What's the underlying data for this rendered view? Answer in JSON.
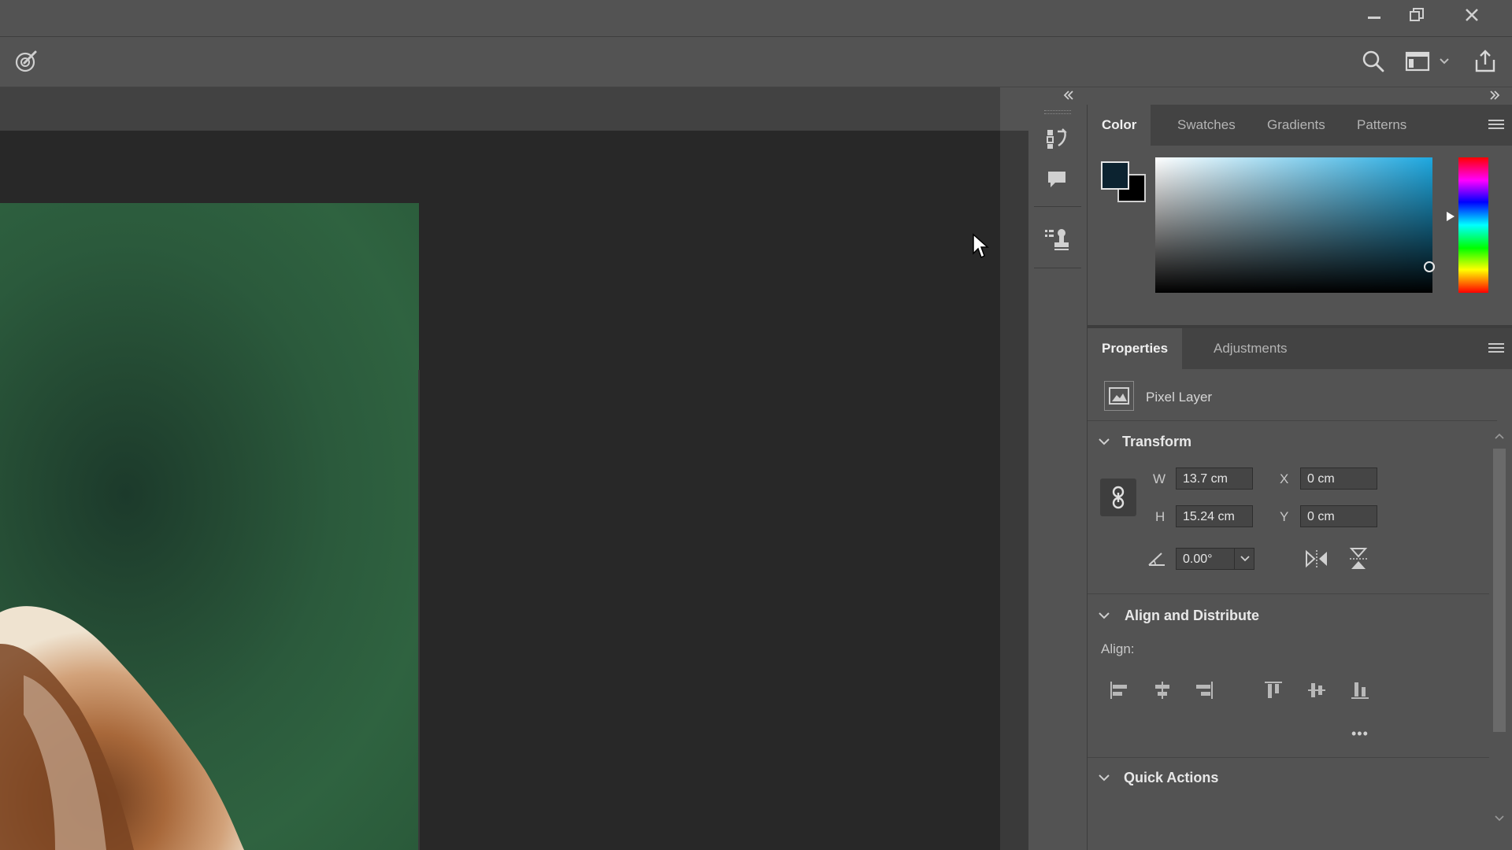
{
  "titlebar": {
    "buttons": [
      "minimize-icon",
      "restore-icon",
      "close-icon"
    ]
  },
  "toolbar": {
    "left_icon": "brush-target-icon",
    "right_icons": [
      "search-icon",
      "workspace-icon",
      "chevron-down-icon",
      "share-icon"
    ]
  },
  "color_panel": {
    "tabs": [
      "Color",
      "Swatches",
      "Gradients",
      "Patterns"
    ],
    "active_tab": "Color",
    "foreground_color": "#0c2330",
    "background_color": "#000000",
    "hue_color": "#1ea8e0"
  },
  "properties_panel": {
    "tabs": [
      "Properties",
      "Adjustments"
    ],
    "active_tab": "Properties",
    "layer_type": "Pixel Layer",
    "transform": {
      "title": "Transform",
      "w_label": "W",
      "w_value": "13.7 cm",
      "h_label": "H",
      "h_value": "15.24 cm",
      "x_label": "X",
      "x_value": "0 cm",
      "y_label": "Y",
      "y_value": "0 cm",
      "angle_value": "0.00°"
    },
    "align": {
      "title": "Align and Distribute",
      "label": "Align:",
      "more": "•••"
    },
    "quick_actions": {
      "title": "Quick Actions"
    }
  },
  "colors": {
    "ui_bg": "#535353",
    "canvas_bg": "#282828",
    "panel_tab_bg": "#434343"
  }
}
